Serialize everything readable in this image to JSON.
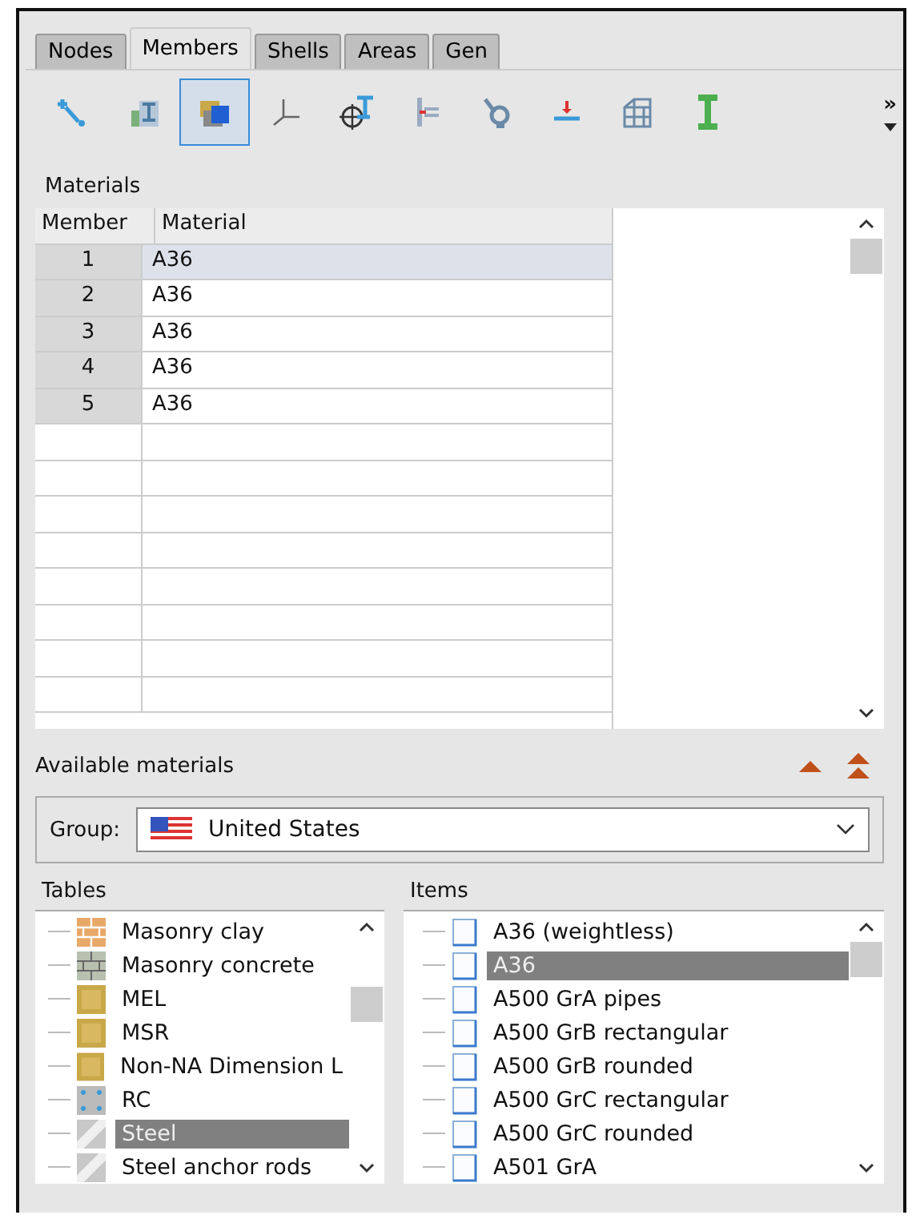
{
  "tabs": [
    {
      "label": "Nodes",
      "selected": false
    },
    {
      "label": "Members",
      "selected": true
    },
    {
      "label": "Shells",
      "selected": false
    },
    {
      "label": "Areas",
      "selected": false
    },
    {
      "label": "Gen",
      "selected": false
    }
  ],
  "toolbar": {
    "tools": [
      {
        "selected": false
      },
      {
        "selected": false
      },
      {
        "selected": true
      },
      {
        "selected": false
      },
      {
        "selected": false
      },
      {
        "selected": false
      },
      {
        "selected": false
      },
      {
        "selected": false
      },
      {
        "selected": false
      },
      {
        "selected": false
      }
    ],
    "overflow": "»"
  },
  "materials": {
    "title": "Materials",
    "columns": [
      "Member",
      "Material"
    ],
    "rows": [
      {
        "member": "1",
        "material": "A36",
        "selected": true
      },
      {
        "member": "2",
        "material": "A36",
        "selected": false
      },
      {
        "member": "3",
        "material": "A36",
        "selected": false
      },
      {
        "member": "4",
        "material": "A36",
        "selected": false
      },
      {
        "member": "5",
        "material": "A36",
        "selected": false
      }
    ]
  },
  "available": {
    "title": "Available materials",
    "group_label": "Group:",
    "group_value": "United States",
    "tables_title": "Tables",
    "items_title": "Items",
    "tables": [
      {
        "label": "Masonry clay",
        "kind": "clay",
        "selected": false
      },
      {
        "label": "Masonry concrete",
        "kind": "concrete",
        "selected": false
      },
      {
        "label": "MEL",
        "kind": "wood",
        "selected": false
      },
      {
        "label": "MSR",
        "kind": "wood",
        "selected": false
      },
      {
        "label": "Non-NA Dimension L",
        "kind": "wood",
        "selected": false
      },
      {
        "label": "RC",
        "kind": "rc",
        "selected": false
      },
      {
        "label": "Steel",
        "kind": "steel",
        "selected": true
      },
      {
        "label": "Steel anchor rods",
        "kind": "steel",
        "selected": false
      }
    ],
    "items": [
      {
        "label": "A36 (weightless)",
        "selected": false
      },
      {
        "label": "A36",
        "selected": true
      },
      {
        "label": "A500 GrA pipes",
        "selected": false
      },
      {
        "label": "A500 GrB rectangular",
        "selected": false
      },
      {
        "label": "A500 GrB rounded",
        "selected": false
      },
      {
        "label": "A500 GrC rectangular",
        "selected": false
      },
      {
        "label": "A500 GrC rounded",
        "selected": false
      },
      {
        "label": "A501 GrA",
        "selected": false
      }
    ]
  }
}
